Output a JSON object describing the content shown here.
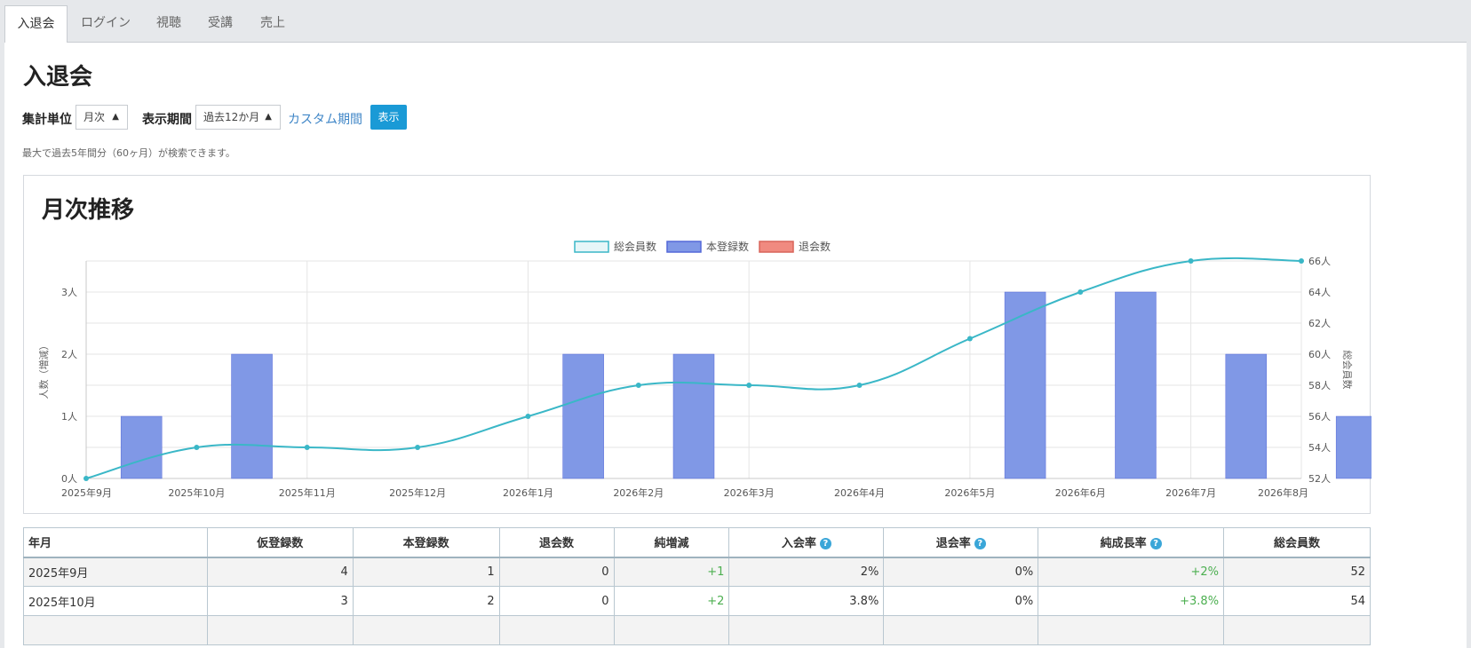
{
  "tabs": [
    "入退会",
    "ログイン",
    "視聴",
    "受講",
    "売上"
  ],
  "page_title": "入退会",
  "filters": {
    "unit_label": "集計単位",
    "unit_value": "月次",
    "period_label": "表示期間",
    "period_value": "過去12か月",
    "custom_link": "カスタム期間",
    "show_button": "表示",
    "note": "最大で過去5年間分（60ヶ月）が検索できます。"
  },
  "chart_card_title": "月次推移",
  "colors": {
    "line": "#3ab7c7",
    "bar": "#8098e6",
    "bar_border": "#5468d8",
    "withdraw": "#f08a80",
    "accent": "#1a9ad6"
  },
  "chart_data": {
    "type": "bar",
    "categories": [
      "2025年9月",
      "2025年10月",
      "2025年11月",
      "2025年12月",
      "2026年1月",
      "2026年2月",
      "2026年3月",
      "2026年4月",
      "2026年5月",
      "2026年6月",
      "2026年7月",
      "2026年8月"
    ],
    "series": [
      {
        "name": "総会員数",
        "type": "line",
        "axis": "right",
        "values": [
          52,
          54,
          54,
          54,
          56,
          58,
          58,
          58,
          61,
          64,
          66,
          66
        ]
      },
      {
        "name": "本登録数",
        "type": "bar",
        "axis": "left",
        "values": [
          1,
          2,
          0,
          0,
          2,
          2,
          0,
          0,
          3,
          3,
          2,
          1
        ]
      },
      {
        "name": "退会数",
        "type": "bar",
        "axis": "left",
        "values": [
          0,
          0,
          0,
          0,
          0,
          0,
          0,
          0,
          0,
          0,
          0,
          0
        ]
      }
    ],
    "left_ticks": [
      "0人",
      "1人",
      "2人",
      "3人"
    ],
    "right_ticks": [
      "52人",
      "54人",
      "56人",
      "58人",
      "60人",
      "62人",
      "64人",
      "66人"
    ],
    "ylabel_left": "人数（増減）",
    "ylabel_right": "総会員数",
    "ylim_left": [
      0,
      3.5
    ],
    "ylim_right": [
      52,
      66
    ],
    "legend_position": "top-center",
    "grid": true
  },
  "table": {
    "headers": [
      "年月",
      "仮登録数",
      "本登録数",
      "退会数",
      "純増減",
      "入会率",
      "退会率",
      "純成長率",
      "総会員数"
    ],
    "help_columns": [
      5,
      6,
      7
    ],
    "rows": [
      [
        "2025年9月",
        "4",
        "1",
        "0",
        "+1",
        "2%",
        "0%",
        "+2%",
        "52"
      ],
      [
        "2025年10月",
        "3",
        "2",
        "0",
        "+2",
        "3.8%",
        "0%",
        "+3.8%",
        "54"
      ],
      [
        "",
        "",
        "",
        "",
        "",
        "",
        "",
        "",
        ""
      ]
    ]
  }
}
